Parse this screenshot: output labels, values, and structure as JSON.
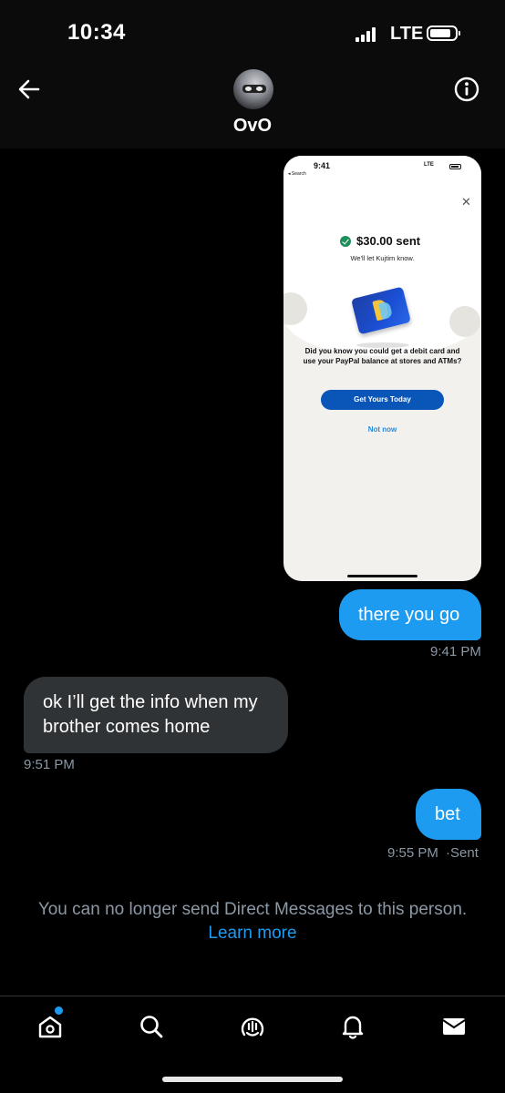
{
  "status_bar": {
    "time": "10:34",
    "network": "LTE"
  },
  "header": {
    "contact_name": "OvO"
  },
  "shared_image": {
    "time": "9:41",
    "back_label": "◂ Search",
    "network": "LTE",
    "amount": "$30.00 sent",
    "note": "We'll let Kujtim know.",
    "description": "Did you know you could get a debit card and use your PayPal balance at stores and ATMs?",
    "cta_button": "Get Yours Today",
    "secondary_button": "Not now"
  },
  "messages": [
    {
      "direction": "outgoing",
      "text": "there you go",
      "time": "9:41 PM"
    },
    {
      "direction": "incoming",
      "text": "ok I’ll get the info when my brother comes home",
      "time": "9:51 PM"
    },
    {
      "direction": "outgoing",
      "text": "bet",
      "time": "9:55 PM",
      "status": "·Sent"
    }
  ],
  "notice": {
    "text": "You can no longer send Direct Messages to this person.",
    "link": "Learn more"
  },
  "tab_bar": {
    "items": [
      "home-icon",
      "search-icon",
      "spaces-icon",
      "notifications-icon",
      "messages-icon"
    ],
    "notification_dot_color": "#1d9bf0"
  },
  "colors": {
    "accent": "#1d9bf0",
    "incoming_bubble": "#2f3336",
    "muted_text": "#8b98a5"
  }
}
